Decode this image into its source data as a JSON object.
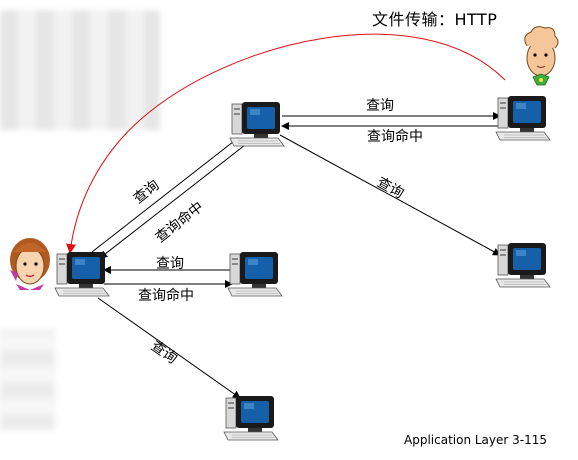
{
  "title": "文件传输：HTTP",
  "footer": "Application Layer  3-115",
  "edges": {
    "top_query": "查询",
    "top_hit": "查询命中",
    "right_query": "查询",
    "diag_query": "查询",
    "diag_hit": "查询命中",
    "mid_query": "查询",
    "mid_hit": "查询命中",
    "bottom_query": "查询"
  },
  "colors": {
    "http_arrow": "#e01010",
    "monitor_frame": "#1a1a1a",
    "screen": "#1560a8",
    "case": "#d8d8d8"
  }
}
